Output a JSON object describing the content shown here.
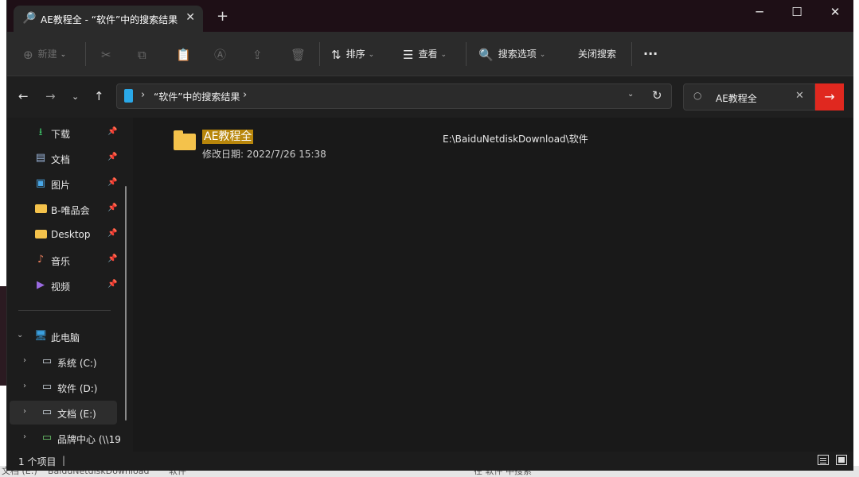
{
  "window": {
    "tab_title": "AE教程全 - “软件”中的搜索结果",
    "tab_close": "✕",
    "new_tab": "+",
    "minimize": "─",
    "maximize": "☐",
    "close": "✕"
  },
  "toolbar": {
    "new_label": "新建",
    "sort_label": "排序",
    "view_label": "查看",
    "search_options_label": "搜索选项",
    "close_search_label": "关闭搜索",
    "more_label": "···"
  },
  "nav": {
    "address_text": "“软件”中的搜索结果",
    "search_value": "AE教程全"
  },
  "sidebar": {
    "quick_access": [
      {
        "label": "下载",
        "icon": "download-icon"
      },
      {
        "label": "文档",
        "icon": "document-icon"
      },
      {
        "label": "图片",
        "icon": "pictures-icon"
      },
      {
        "label": "B-唯品会",
        "icon": "folder-icon"
      },
      {
        "label": "Desktop",
        "icon": "folder-icon"
      },
      {
        "label": "音乐",
        "icon": "music-icon"
      },
      {
        "label": "视频",
        "icon": "video-icon"
      }
    ],
    "this_pc": "此电脑",
    "drives": [
      {
        "label": "系统 (C:)"
      },
      {
        "label": "软件 (D:)"
      },
      {
        "label": "文档 (E:)"
      },
      {
        "label": "品牌中心 (\\\\19"
      }
    ]
  },
  "results": [
    {
      "name": "AE教程全",
      "modified": "修改日期: 2022/7/26 15:38",
      "path": "E:\\BaiduNetdiskDownload\\软件"
    }
  ],
  "status": {
    "item_count": "1 个项目",
    "separator": "|"
  },
  "background": {
    "bottom_crumb_1": "文档 (E:)",
    "bottom_crumb_2": "BaiduNetdiskDownload",
    "bottom_crumb_3": "软件",
    "bottom_search": "在 软件 中搜索"
  },
  "colors": {
    "accent_red": "#e0281f",
    "highlight": "#b8860b",
    "folder": "#f4c24b"
  }
}
